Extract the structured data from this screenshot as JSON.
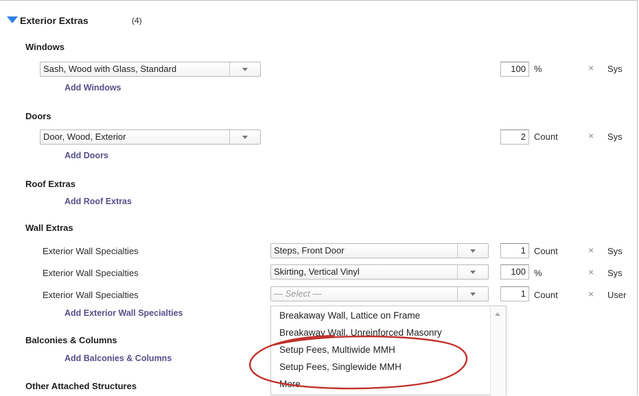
{
  "section": {
    "title": "Exterior Extras",
    "count": "(4)"
  },
  "windows": {
    "title": "Windows",
    "select": "Sash, Wood with Glass, Standard",
    "qty": "100",
    "unit": "%",
    "source": "Sys",
    "add": "Add Windows"
  },
  "doors": {
    "title": "Doors",
    "select": "Door, Wood, Exterior",
    "qty": "2",
    "unit": "Count",
    "source": "Sys",
    "add": "Add Doors"
  },
  "roof": {
    "title": "Roof Extras",
    "add": "Add Roof Extras"
  },
  "wall": {
    "title": "Wall Extras",
    "rows": [
      {
        "label": "Exterior Wall Specialties",
        "select": "Steps, Front Door",
        "qty": "1",
        "unit": "Count",
        "source": "Sys"
      },
      {
        "label": "Exterior Wall Specialties",
        "select": "Skirting, Vertical Vinyl",
        "qty": "100",
        "unit": "%",
        "source": "Sys"
      },
      {
        "label": "Exterior Wall Specialties",
        "select": "— Select —",
        "qty": "1",
        "unit": "Count",
        "source": "User"
      }
    ],
    "add": "Add Exterior Wall Specialties"
  },
  "balconies": {
    "title": "Balconies & Columns",
    "add": "Add Balconies & Columns"
  },
  "other": {
    "title": "Other Attached Structures"
  },
  "dropdown": {
    "options": [
      "Breakaway Wall, Lattice on Frame",
      "Breakaway Wall, Unreinforced Masonry",
      "Setup Fees, Multiwide MMH",
      "Setup Fees, Singlewide MMH",
      "More"
    ]
  },
  "icons": {
    "remove": "×"
  },
  "colors": {
    "accent": "#2f7fe6",
    "link": "#55508a",
    "highlight": "#c0312b"
  }
}
